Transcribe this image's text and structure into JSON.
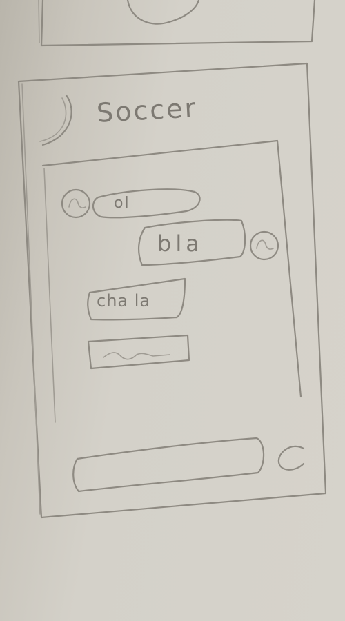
{
  "header": {
    "title": "Soccer"
  },
  "chat": {
    "messages": [
      {
        "text": "ol",
        "side": "left"
      },
      {
        "text": "bla",
        "side": "right"
      },
      {
        "text": "cha la",
        "side": "left"
      },
      {
        "text": "~",
        "side": "left"
      }
    ]
  },
  "composer": {
    "placeholder": ""
  },
  "icons": {
    "back": "back-icon",
    "avatar": "avatar-icon",
    "send": "send-icon"
  }
}
